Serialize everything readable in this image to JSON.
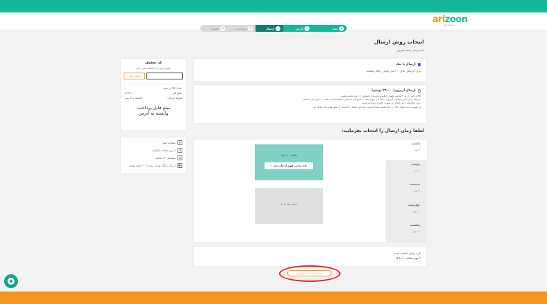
{
  "brand": {
    "logo_main": "ari",
    "logo_accent": "zoon",
    "logo_sub": "فروشگاه آنلاین"
  },
  "steps": [
    {
      "label": "سبد",
      "num": "۱",
      "state": "done"
    },
    {
      "label": "آدرس",
      "num": "۲",
      "state": "done"
    },
    {
      "label": "ارسال",
      "num": "۳",
      "state": "active"
    },
    {
      "label": "پرداخت",
      "num": "۴",
      "state": "todo"
    },
    {
      "label": "تکمیل",
      "num": "۵",
      "state": "todo"
    }
  ],
  "page": {
    "title": "انتخاب روش ارسال",
    "customer": "نام خریدار: محمد قنبرپور"
  },
  "discount": {
    "title": "کد تخفیف",
    "hint": "اولین خرید را با تخفیف تجربه کنید",
    "button": "تاییدیه کوپن"
  },
  "summary": {
    "rows": [
      {
        "label": "تعداد کالا در سبد:",
        "value": "۱"
      },
      {
        "label": "مبلغ کل:",
        "value": "۸،۳۲۶،۰۰۰"
      },
      {
        "label": "هزینه ارسال:",
        "value": "وابسته به آدرس"
      }
    ],
    "payable_label": "مبلغ قابل پرداخت:",
    "payable_value": "وابسته به آدرس"
  },
  "features": [
    {
      "icon": "shield-icon",
      "text": "ضمانت اصل"
    },
    {
      "icon": "return-icon",
      "text": "۷ روز ضمانت بازگشت"
    },
    {
      "icon": "headset-icon",
      "text": "پشتیبانی ۲۴ ساعته"
    },
    {
      "icon": "truck-icon",
      "text": "ارسال رایگان تهران بیش از ۴۰۰ هزار تومان"
    }
  ],
  "shipping": {
    "option1": {
      "title": "ارسال با پیک",
      "desc": "برای خریدهای بالای ۴۰۰ هزار تومان، رایگان میباشد.",
      "selected": true
    },
    "option2": {
      "title": "ارسال آریزون(۳۹،۰۰۰ تومان)",
      "lines": [
        "کالای خود را زیر ۲ ساعت تحویل گرفته و تجربه‌ای لذتبخش از خرید داشته باشید.",
        "شرایط زمان‌بندی و فعالیت آریزون: شنبه الی چهارشنبه ۱۰ صبح الی ۶ عصر، پنجشنبه‌ها از ساعت ۱۰ صبح الی ۵ عصر",
        "برای ابتدا‌شده با این امکان به صورت کانتری پرداخت نمایید.",
        "در صورت عدم تحویل کالا در زمان تعیین شده، آریزون بابت هر دقیقه ۵۰۰ تومان از مبلغ نهایی کم خواهد کرد."
      ],
      "selected": false
    }
  },
  "schedule": {
    "title": "لطفا زمان ارسال را انتخاب بفرمایید:",
    "days": [
      {
        "name": "یکشنبه",
        "date": "۷ مهر",
        "selected": true
      },
      {
        "name": "دوشنبه",
        "date": "۸ مهر",
        "selected": false
      },
      {
        "name": "سه‌شنبه",
        "date": "۹ مهر",
        "selected": false
      },
      {
        "name": "چهارشنبه",
        "date": "۱۰ مهر",
        "selected": false
      },
      {
        "name": "پنجشنبه",
        "date": "۱۱ مهر",
        "selected": false
      }
    ],
    "slot1": {
      "time": "ساعت ۱۰ تا ۱۵",
      "badge": "بازه زمانی فوق انتخاب شد"
    },
    "slot2": {
      "time": "ساعت ۱۵ تا ۲۰"
    },
    "selected_label": "بازه زمانی انتخاب شده",
    "selected_value": "۷ مهر ساعت ۱۰ تا ۱۵"
  },
  "confirm_button": "تایید و ادامه ثبت سفارش",
  "colors": {
    "primary": "#17b59a",
    "accent": "#f7941d",
    "highlight": "#e3222a"
  }
}
